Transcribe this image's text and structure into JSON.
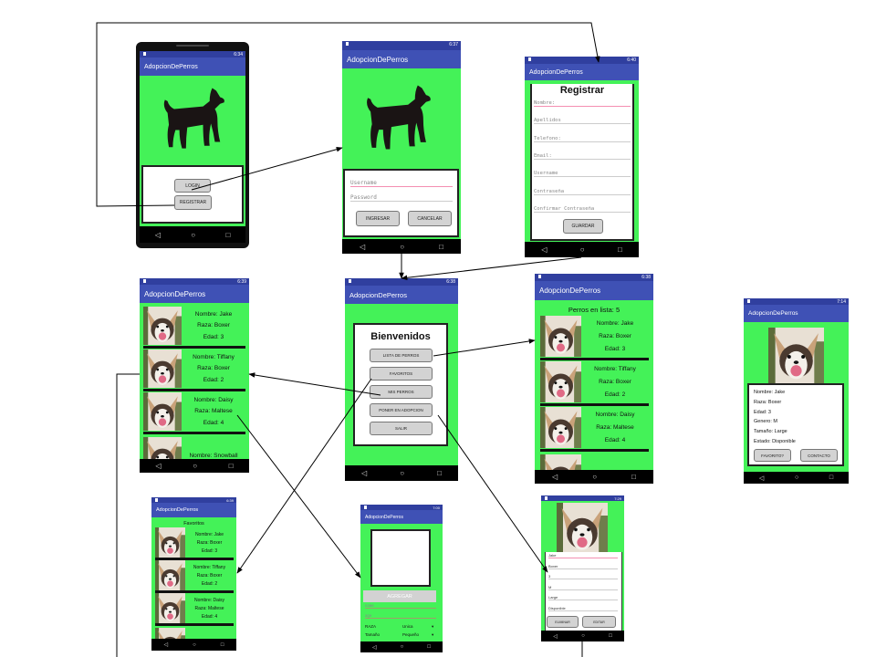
{
  "app_title": "AdopcionDePerros",
  "login": {
    "time": "6:34",
    "login_label": "LOGIN",
    "registrar_label": "REGISTRAR"
  },
  "login_form": {
    "time": "6:37",
    "username_placeholder": "Username",
    "password_placeholder": "Password",
    "ingresar_label": "INGRESAR",
    "cancelar_label": "CANCELAR"
  },
  "registrar": {
    "time": "6:40",
    "title": "Registrar",
    "fields": [
      "Nombre:",
      "Apellidos",
      "Telefono:",
      "Email:",
      "Username",
      "Contraseña",
      "Confirmar Contraseña"
    ],
    "guardar_label": "GUARDAR"
  },
  "mis_perros": {
    "time": "6:39"
  },
  "menu": {
    "time": "6:38",
    "title": "Bienvenidos",
    "buttons": [
      "LISTA DE PERROS",
      "FAVORITOS",
      "MIS PERROS",
      "PONER EN ADOPCION",
      "SALIR"
    ]
  },
  "lista": {
    "time": "6:38",
    "count_label": "Perros en lista: 5"
  },
  "detalle": {
    "time": "7:14",
    "lines": [
      "Nombre: Jake",
      "Raza: Boxer",
      "Edad: 3",
      "Genero: M",
      "Tamaño: Large",
      "Estado: Disponible"
    ],
    "favorito_label": "FAVORITO?",
    "contacto_label": "CONTACTO"
  },
  "favoritos": {
    "time": "6:39",
    "title": "Favoritos"
  },
  "agregar": {
    "time": "7:00",
    "agregar_label": "AGREGAR",
    "name_placeholder": "name",
    "age_placeholder": "age",
    "raza_label": "RAZA",
    "raza_value": "Unica",
    "tamano_label": "Tamaño",
    "tamano_value": "Pequeño"
  },
  "editar": {
    "time": "7:29",
    "values": [
      "Jake",
      "Boxer",
      "3",
      "M",
      "Large",
      "Disponible"
    ],
    "eliminar_label": "ELIMINAR",
    "editar_label": "EDITAR"
  },
  "dogs": [
    {
      "nombre": "Nombre: Jake",
      "raza": "Raza: Boxer",
      "edad": "Edad: 3"
    },
    {
      "nombre": "Nombre: Tiffany",
      "raza": "Raza: Boxer",
      "edad": "Edad: 2"
    },
    {
      "nombre": "Nombre: Daisy",
      "raza": "Raza: Maltese",
      "edad": "Edad: 4"
    },
    {
      "nombre": "Nombre: Snowball",
      "raza": "",
      "edad": ""
    }
  ],
  "colors": {
    "status_bar": "#303f9f",
    "app_bar": "#3f51b5",
    "screen_bg": "#44f258",
    "button": "#d3d3d3"
  },
  "icons": [
    "dog-silhouette-icon",
    "dog-photo",
    "nav-back-icon",
    "nav-home-icon",
    "nav-recent-icon",
    "battery-icon"
  ]
}
